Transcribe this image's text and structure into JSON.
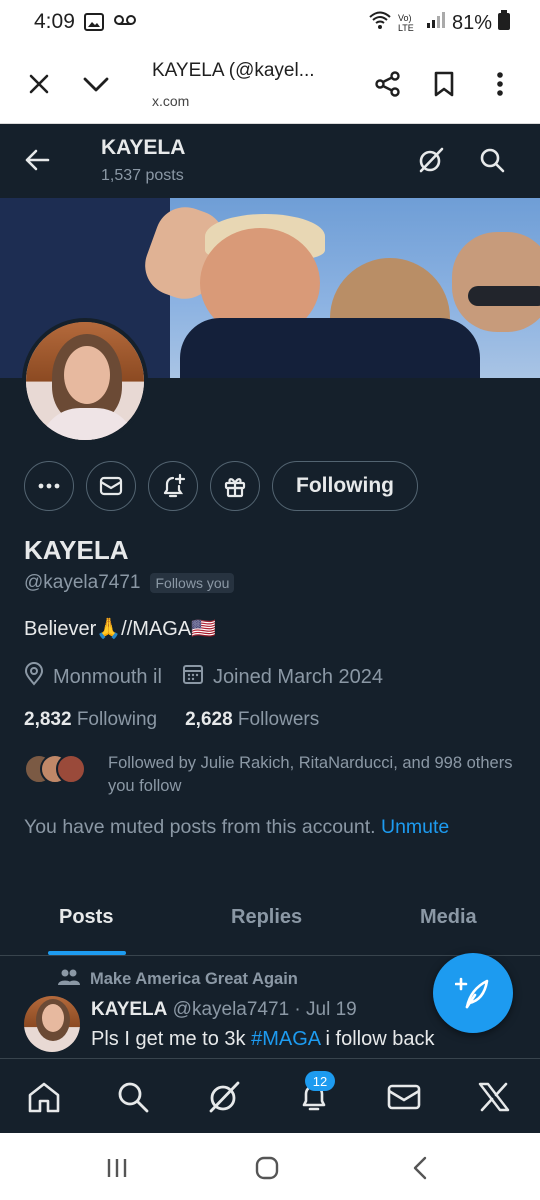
{
  "status_bar": {
    "time": "4:09",
    "network_label": "Vo) LTE",
    "battery": "81%"
  },
  "browser": {
    "title": "KAYELA (@kayel...",
    "url": "x.com"
  },
  "header": {
    "name": "KAYELA",
    "posts_count": "1,537 posts"
  },
  "profile": {
    "display_name": "KAYELA",
    "handle": "@kayela7471",
    "follows_you": "Follows you",
    "bio": "Believer🙏//MAGA🇺🇸",
    "location": "Monmouth il",
    "joined": "Joined March 2024",
    "following_count": "2,832",
    "following_label": "Following",
    "followers_count": "2,628",
    "followers_label": "Followers",
    "followed_by": "Followed by Julie Rakich, RitaNarducci, and 998 others you follow",
    "muted_text": "You have muted posts from this account.",
    "unmute_label": "Unmute",
    "following_button": "Following"
  },
  "tabs": [
    {
      "label": "Posts"
    },
    {
      "label": "Replies"
    },
    {
      "label": "Media"
    }
  ],
  "post": {
    "context": "Make America Great Again",
    "name": "KAYELA",
    "meta": "@kayela7471 · Jul 19",
    "text": "Pls I get me to 3k ",
    "hashtag": "#MAGA",
    "text_after": " i follow back"
  },
  "nav": {
    "notifications_badge": "12"
  },
  "colors": {
    "background": "#15202b",
    "accent": "#1d9bf0",
    "secondary_text": "#8b98a5"
  }
}
